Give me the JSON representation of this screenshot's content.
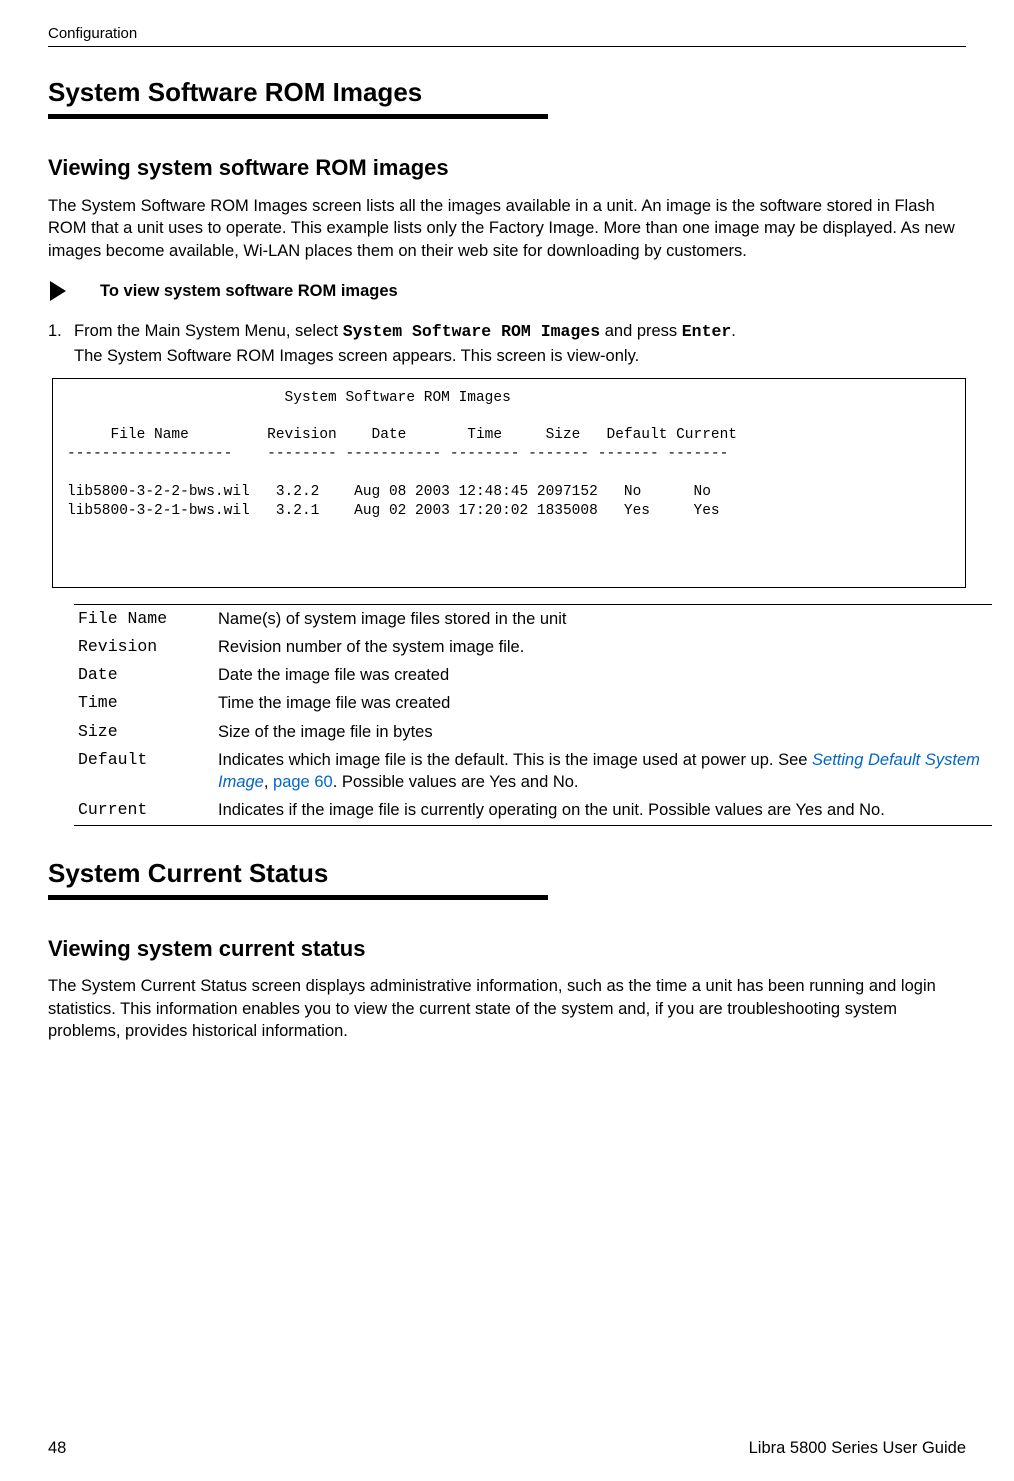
{
  "header": {
    "section": "Configuration"
  },
  "section1": {
    "title": "System Software ROM Images",
    "subtitle": "Viewing system software ROM images",
    "intro_para": "The System Software ROM Images screen lists all the images available in a unit. An image is the software stored in Flash ROM that a unit uses to operate. This example lists only the Factory Image. More than one image may be displayed. As new images become available, Wi-LAN places them on their web site for downloading by customers.",
    "proc_title": "To view system software ROM images",
    "step1_pre": "From the Main System Menu, select ",
    "step1_menu": "System Software ROM Images",
    "step1_mid": " and press ",
    "step1_key": "Enter",
    "step1_post": ".",
    "step1_sub": "The System Software ROM Images screen appears. This screen is view-only.",
    "screen_text": "                         System Software ROM Images\n\n     File Name         Revision    Date       Time     Size   Default Current\n-------------------    -------- ----------- -------- ------- ------- -------\n\nlib5800-3-2-2-bws.wil   3.2.2    Aug 08 2003 12:48:45 2097152   No      No\nlib5800-3-2-1-bws.wil   3.2.1    Aug 02 2003 17:20:02 1835008   Yes     Yes",
    "defs": {
      "file_name_t": "File Name",
      "file_name_d": "Name(s) of system image files stored in the unit",
      "revision_t": "Revision",
      "revision_d": "Revision number of the system image file.",
      "date_t": "Date",
      "date_d": "Date the image file was created",
      "time_t": "Time",
      "time_d": "Time the image file was created",
      "size_t": "Size",
      "size_d": "Size of the image file in bytes",
      "default_t": "Default",
      "default_d_pre": "Indicates which image file is the default. This is the image used at power up. See ",
      "default_d_link1": "Setting Default System Image",
      "default_d_mid": ", ",
      "default_d_link2": "page 60",
      "default_d_post": ". Possible values are Yes and No.",
      "current_t": "Current",
      "current_d": "Indicates if the image file is currently operating on the unit. Possible values are Yes and No."
    }
  },
  "section2": {
    "title": "System Current Status",
    "subtitle": "Viewing system current status",
    "intro_para": "The System Current Status screen displays administrative information, such as the time a unit has been running and login statistics. This information enables you to view the current state of the system and, if you are troubleshooting system problems, provides historical information."
  },
  "footer": {
    "page": "48",
    "guide": "Libra 5800 Series User Guide"
  }
}
